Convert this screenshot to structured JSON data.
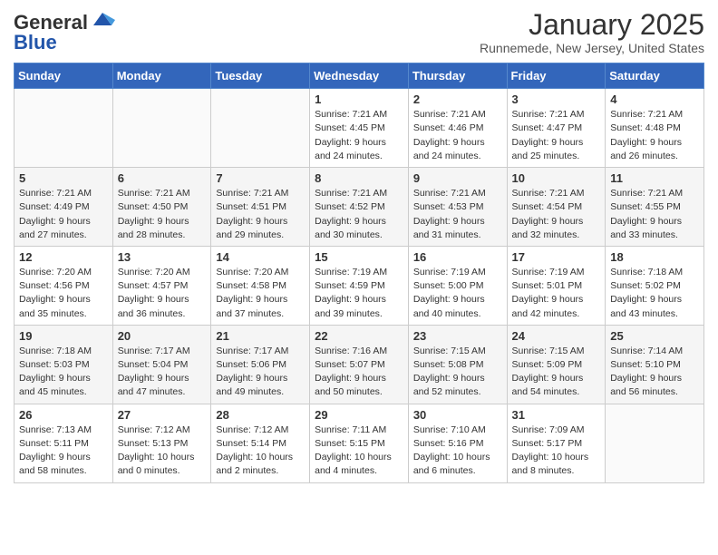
{
  "logo": {
    "general": "General",
    "blue": "Blue"
  },
  "header": {
    "month": "January 2025",
    "location": "Runnemede, New Jersey, United States"
  },
  "weekdays": [
    "Sunday",
    "Monday",
    "Tuesday",
    "Wednesday",
    "Thursday",
    "Friday",
    "Saturday"
  ],
  "weeks": [
    [
      {
        "day": "",
        "sunrise": "",
        "sunset": "",
        "daylight": ""
      },
      {
        "day": "",
        "sunrise": "",
        "sunset": "",
        "daylight": ""
      },
      {
        "day": "",
        "sunrise": "",
        "sunset": "",
        "daylight": ""
      },
      {
        "day": "1",
        "sunrise": "Sunrise: 7:21 AM",
        "sunset": "Sunset: 4:45 PM",
        "daylight": "Daylight: 9 hours and 24 minutes."
      },
      {
        "day": "2",
        "sunrise": "Sunrise: 7:21 AM",
        "sunset": "Sunset: 4:46 PM",
        "daylight": "Daylight: 9 hours and 24 minutes."
      },
      {
        "day": "3",
        "sunrise": "Sunrise: 7:21 AM",
        "sunset": "Sunset: 4:47 PM",
        "daylight": "Daylight: 9 hours and 25 minutes."
      },
      {
        "day": "4",
        "sunrise": "Sunrise: 7:21 AM",
        "sunset": "Sunset: 4:48 PM",
        "daylight": "Daylight: 9 hours and 26 minutes."
      }
    ],
    [
      {
        "day": "5",
        "sunrise": "Sunrise: 7:21 AM",
        "sunset": "Sunset: 4:49 PM",
        "daylight": "Daylight: 9 hours and 27 minutes."
      },
      {
        "day": "6",
        "sunrise": "Sunrise: 7:21 AM",
        "sunset": "Sunset: 4:50 PM",
        "daylight": "Daylight: 9 hours and 28 minutes."
      },
      {
        "day": "7",
        "sunrise": "Sunrise: 7:21 AM",
        "sunset": "Sunset: 4:51 PM",
        "daylight": "Daylight: 9 hours and 29 minutes."
      },
      {
        "day": "8",
        "sunrise": "Sunrise: 7:21 AM",
        "sunset": "Sunset: 4:52 PM",
        "daylight": "Daylight: 9 hours and 30 minutes."
      },
      {
        "day": "9",
        "sunrise": "Sunrise: 7:21 AM",
        "sunset": "Sunset: 4:53 PM",
        "daylight": "Daylight: 9 hours and 31 minutes."
      },
      {
        "day": "10",
        "sunrise": "Sunrise: 7:21 AM",
        "sunset": "Sunset: 4:54 PM",
        "daylight": "Daylight: 9 hours and 32 minutes."
      },
      {
        "day": "11",
        "sunrise": "Sunrise: 7:21 AM",
        "sunset": "Sunset: 4:55 PM",
        "daylight": "Daylight: 9 hours and 33 minutes."
      }
    ],
    [
      {
        "day": "12",
        "sunrise": "Sunrise: 7:20 AM",
        "sunset": "Sunset: 4:56 PM",
        "daylight": "Daylight: 9 hours and 35 minutes."
      },
      {
        "day": "13",
        "sunrise": "Sunrise: 7:20 AM",
        "sunset": "Sunset: 4:57 PM",
        "daylight": "Daylight: 9 hours and 36 minutes."
      },
      {
        "day": "14",
        "sunrise": "Sunrise: 7:20 AM",
        "sunset": "Sunset: 4:58 PM",
        "daylight": "Daylight: 9 hours and 37 minutes."
      },
      {
        "day": "15",
        "sunrise": "Sunrise: 7:19 AM",
        "sunset": "Sunset: 4:59 PM",
        "daylight": "Daylight: 9 hours and 39 minutes."
      },
      {
        "day": "16",
        "sunrise": "Sunrise: 7:19 AM",
        "sunset": "Sunset: 5:00 PM",
        "daylight": "Daylight: 9 hours and 40 minutes."
      },
      {
        "day": "17",
        "sunrise": "Sunrise: 7:19 AM",
        "sunset": "Sunset: 5:01 PM",
        "daylight": "Daylight: 9 hours and 42 minutes."
      },
      {
        "day": "18",
        "sunrise": "Sunrise: 7:18 AM",
        "sunset": "Sunset: 5:02 PM",
        "daylight": "Daylight: 9 hours and 43 minutes."
      }
    ],
    [
      {
        "day": "19",
        "sunrise": "Sunrise: 7:18 AM",
        "sunset": "Sunset: 5:03 PM",
        "daylight": "Daylight: 9 hours and 45 minutes."
      },
      {
        "day": "20",
        "sunrise": "Sunrise: 7:17 AM",
        "sunset": "Sunset: 5:04 PM",
        "daylight": "Daylight: 9 hours and 47 minutes."
      },
      {
        "day": "21",
        "sunrise": "Sunrise: 7:17 AM",
        "sunset": "Sunset: 5:06 PM",
        "daylight": "Daylight: 9 hours and 49 minutes."
      },
      {
        "day": "22",
        "sunrise": "Sunrise: 7:16 AM",
        "sunset": "Sunset: 5:07 PM",
        "daylight": "Daylight: 9 hours and 50 minutes."
      },
      {
        "day": "23",
        "sunrise": "Sunrise: 7:15 AM",
        "sunset": "Sunset: 5:08 PM",
        "daylight": "Daylight: 9 hours and 52 minutes."
      },
      {
        "day": "24",
        "sunrise": "Sunrise: 7:15 AM",
        "sunset": "Sunset: 5:09 PM",
        "daylight": "Daylight: 9 hours and 54 minutes."
      },
      {
        "day": "25",
        "sunrise": "Sunrise: 7:14 AM",
        "sunset": "Sunset: 5:10 PM",
        "daylight": "Daylight: 9 hours and 56 minutes."
      }
    ],
    [
      {
        "day": "26",
        "sunrise": "Sunrise: 7:13 AM",
        "sunset": "Sunset: 5:11 PM",
        "daylight": "Daylight: 9 hours and 58 minutes."
      },
      {
        "day": "27",
        "sunrise": "Sunrise: 7:12 AM",
        "sunset": "Sunset: 5:13 PM",
        "daylight": "Daylight: 10 hours and 0 minutes."
      },
      {
        "day": "28",
        "sunrise": "Sunrise: 7:12 AM",
        "sunset": "Sunset: 5:14 PM",
        "daylight": "Daylight: 10 hours and 2 minutes."
      },
      {
        "day": "29",
        "sunrise": "Sunrise: 7:11 AM",
        "sunset": "Sunset: 5:15 PM",
        "daylight": "Daylight: 10 hours and 4 minutes."
      },
      {
        "day": "30",
        "sunrise": "Sunrise: 7:10 AM",
        "sunset": "Sunset: 5:16 PM",
        "daylight": "Daylight: 10 hours and 6 minutes."
      },
      {
        "day": "31",
        "sunrise": "Sunrise: 7:09 AM",
        "sunset": "Sunset: 5:17 PM",
        "daylight": "Daylight: 10 hours and 8 minutes."
      },
      {
        "day": "",
        "sunrise": "",
        "sunset": "",
        "daylight": ""
      }
    ]
  ]
}
